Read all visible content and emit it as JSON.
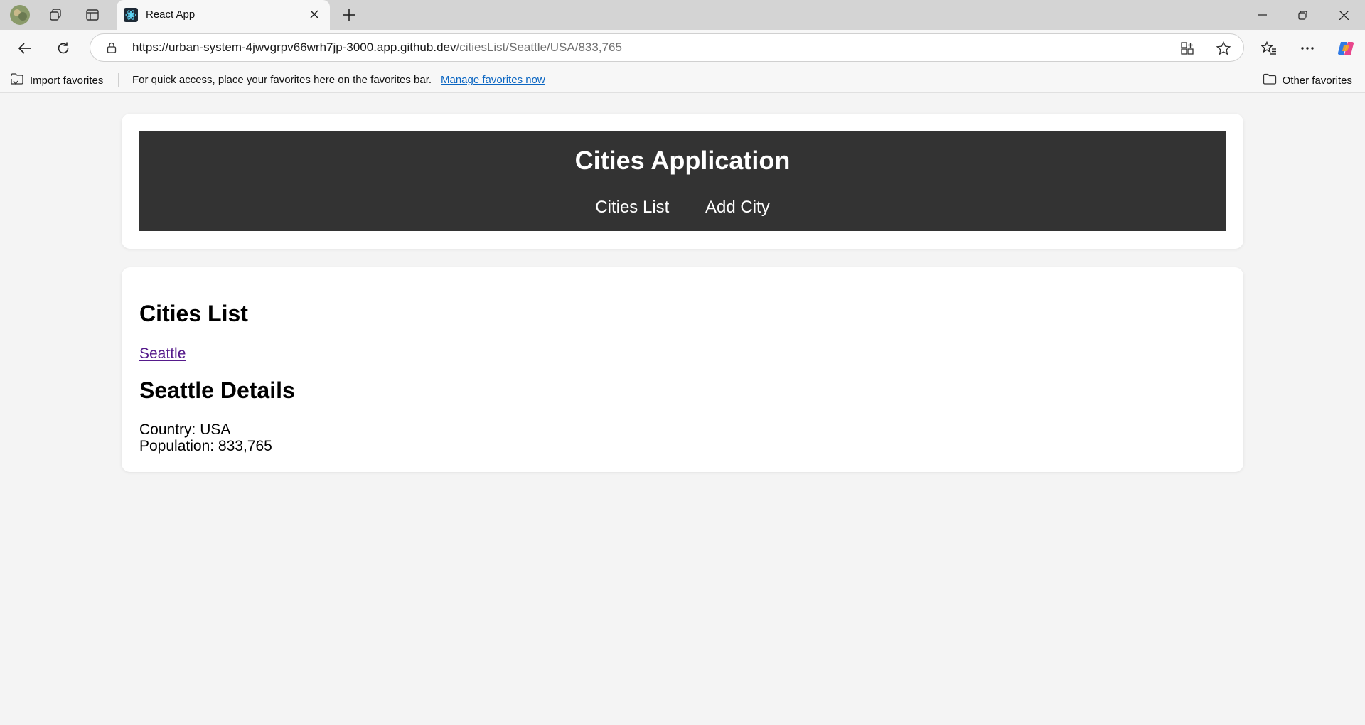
{
  "browser": {
    "tab": {
      "title": "React App",
      "favicon": "react-icon"
    },
    "address": {
      "url_host": "https://urban-system-4jwvgrpv66wrh7jp-3000.app.github.dev",
      "url_path": "/citiesList/Seattle/USA/833,765"
    },
    "favorites_bar": {
      "import_label": "Import favorites",
      "message": "For quick access, place your favorites here on the favorites bar.",
      "manage_link": "Manage favorites now",
      "other_label": "Other favorites"
    },
    "colors": {
      "tabbar": "#d4d4d4",
      "toolbar": "#f7f7f7",
      "link": "#0b66c2"
    }
  },
  "app": {
    "title": "Cities Application",
    "nav": [
      {
        "label": "Cities List"
      },
      {
        "label": "Add City"
      }
    ],
    "colors": {
      "header_bg": "#333333",
      "page_bg": "#f4f4f4",
      "visited_link": "#551a8b"
    }
  },
  "main": {
    "list_heading": "Cities List",
    "cities": [
      {
        "name": "Seattle"
      }
    ],
    "details_heading": "Seattle Details",
    "country_text": "Country: USA",
    "population_text": "Population: 833,765"
  }
}
